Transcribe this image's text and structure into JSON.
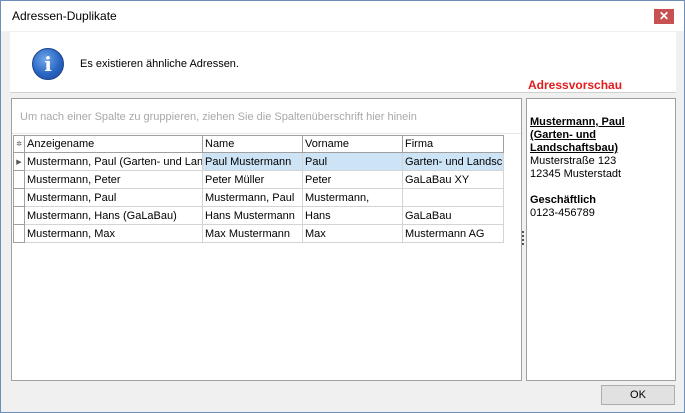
{
  "window": {
    "title": "Adressen-Duplikate",
    "close_glyph": "✕"
  },
  "info": {
    "icon": "info-icon",
    "icon_glyph": "i",
    "message": "Es existieren ähnliche Adressen."
  },
  "grid": {
    "group_hint": "Um nach einer Spalte zu gruppieren, ziehen Sie die Spaltenüberschrift hier hinein",
    "columns": [
      "Anzeigename",
      "Name",
      "Vorname",
      "Firma"
    ],
    "rows": [
      {
        "anzeigename": "Mustermann, Paul (Garten- und Landschaftsbau)",
        "name": "Paul Mustermann",
        "vorname": "Paul",
        "firma": "Garten- und Landschaftsbau",
        "selected": true
      },
      {
        "anzeigename": "Mustermann, Peter",
        "name": "Peter Müller",
        "vorname": "Peter",
        "firma": "GaLaBau XY",
        "selected": false
      },
      {
        "anzeigename": "Mustermann, Paul",
        "name": "Mustermann, Paul",
        "vorname": "Mustermann,",
        "firma": "",
        "selected": false
      },
      {
        "anzeigename": "Mustermann, Hans (GaLaBau)",
        "name": "Hans Mustermann",
        "vorname": "Hans",
        "firma": "GaLaBau",
        "selected": false
      },
      {
        "anzeigename": "Mustermann, Max",
        "name": "Max Mustermann",
        "vorname": "Max",
        "firma": "Mustermann AG",
        "selected": false
      }
    ]
  },
  "preview": {
    "heading": "Adressvorschau",
    "name": "Mustermann, Paul (Garten- und Landschaftsbau)",
    "street": "Musterstraße 123",
    "city": "12345 Musterstadt",
    "business_label": "Geschäftlich",
    "phone": "0123-456789"
  },
  "buttons": {
    "ok_label": "OK"
  },
  "colors": {
    "preview_heading": "#e31b1b",
    "selected_row": "#cde4f7",
    "close_button": "#c75050"
  }
}
